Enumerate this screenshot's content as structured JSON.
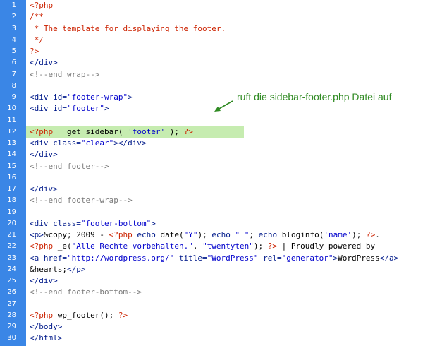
{
  "editor": {
    "gutter_color": "#3a86e6",
    "highlight_color": "#c6ecb0",
    "highlight_line": 12,
    "lines": [
      {
        "n": "1",
        "segs": [
          {
            "t": "<?php",
            "c": "php"
          }
        ]
      },
      {
        "n": "2",
        "segs": [
          {
            "t": "/**",
            "c": "php"
          }
        ]
      },
      {
        "n": "3",
        "segs": [
          {
            "t": " * The template for displaying the footer.",
            "c": "php"
          }
        ]
      },
      {
        "n": "4",
        "segs": [
          {
            "t": " */",
            "c": "php"
          }
        ]
      },
      {
        "n": "5",
        "segs": [
          {
            "t": "?>",
            "c": "php"
          }
        ]
      },
      {
        "n": "6",
        "segs": [
          {
            "t": "</div>",
            "c": "tag"
          }
        ]
      },
      {
        "n": "7",
        "segs": [
          {
            "t": "<!--end wrap-->",
            "c": "cm"
          }
        ]
      },
      {
        "n": "8",
        "segs": []
      },
      {
        "n": "9",
        "segs": [
          {
            "t": "<div id=",
            "c": "tag"
          },
          {
            "t": "\"footer-wrap\"",
            "c": "str"
          },
          {
            "t": ">",
            "c": "tag"
          }
        ]
      },
      {
        "n": "10",
        "segs": [
          {
            "t": "<div id=",
            "c": "tag"
          },
          {
            "t": "\"footer\"",
            "c": "str"
          },
          {
            "t": ">",
            "c": "tag"
          }
        ]
      },
      {
        "n": "11",
        "segs": []
      },
      {
        "n": "12",
        "segs": [
          {
            "t": "<?php",
            "c": "php"
          },
          {
            "t": "   get_sidebar( ",
            "c": "txt"
          },
          {
            "t": "'footer'",
            "c": "str"
          },
          {
            "t": " ); ",
            "c": "txt"
          },
          {
            "t": "?>",
            "c": "php"
          }
        ]
      },
      {
        "n": "13",
        "segs": [
          {
            "t": "<div class=",
            "c": "tag"
          },
          {
            "t": "\"clear\"",
            "c": "str"
          },
          {
            "t": "></div>",
            "c": "tag"
          }
        ]
      },
      {
        "n": "14",
        "segs": [
          {
            "t": "</div>",
            "c": "tag"
          }
        ]
      },
      {
        "n": "15",
        "segs": [
          {
            "t": "<!--end footer-->",
            "c": "cm"
          }
        ]
      },
      {
        "n": "16",
        "segs": []
      },
      {
        "n": "17",
        "segs": [
          {
            "t": "</div>",
            "c": "tag"
          }
        ]
      },
      {
        "n": "18",
        "segs": [
          {
            "t": "<!--end footer-wrap-->",
            "c": "cm"
          }
        ]
      },
      {
        "n": "19",
        "segs": []
      },
      {
        "n": "20",
        "segs": [
          {
            "t": "<div class=",
            "c": "tag"
          },
          {
            "t": "\"footer-bottom\"",
            "c": "str"
          },
          {
            "t": ">",
            "c": "tag"
          }
        ]
      },
      {
        "n": "21",
        "segs": [
          {
            "t": "<p>",
            "c": "tag"
          },
          {
            "t": "&copy; 2009 - ",
            "c": "txt"
          },
          {
            "t": "<?php",
            "c": "php"
          },
          {
            "t": " echo ",
            "c": "tag"
          },
          {
            "t": "date(",
            "c": "txt"
          },
          {
            "t": "\"Y\"",
            "c": "str"
          },
          {
            "t": "); ",
            "c": "txt"
          },
          {
            "t": "echo ",
            "c": "tag"
          },
          {
            "t": "\" \"",
            "c": "str"
          },
          {
            "t": "; ",
            "c": "txt"
          },
          {
            "t": "echo ",
            "c": "tag"
          },
          {
            "t": "bloginfo(",
            "c": "txt"
          },
          {
            "t": "'name'",
            "c": "str"
          },
          {
            "t": "); ",
            "c": "txt"
          },
          {
            "t": "?>",
            "c": "php"
          },
          {
            "t": ".",
            "c": "txt"
          }
        ]
      },
      {
        "n": "22",
        "segs": [
          {
            "t": "<?php",
            "c": "php"
          },
          {
            "t": " _e(",
            "c": "txt"
          },
          {
            "t": "\"Alle Rechte vorbehalten.\"",
            "c": "str"
          },
          {
            "t": ", ",
            "c": "txt"
          },
          {
            "t": "\"twentyten\"",
            "c": "str"
          },
          {
            "t": "); ",
            "c": "txt"
          },
          {
            "t": "?>",
            "c": "php"
          },
          {
            "t": " | Proudly powered by",
            "c": "txt"
          }
        ]
      },
      {
        "n": "23",
        "segs": [
          {
            "t": "<a href=",
            "c": "tag"
          },
          {
            "t": "\"http://wordpress.org/\"",
            "c": "str"
          },
          {
            "t": " title=",
            "c": "tag"
          },
          {
            "t": "\"WordPress\"",
            "c": "str"
          },
          {
            "t": " rel=",
            "c": "tag"
          },
          {
            "t": "\"generator\"",
            "c": "str"
          },
          {
            "t": ">",
            "c": "tag"
          },
          {
            "t": "WordPress",
            "c": "txt"
          },
          {
            "t": "</a>",
            "c": "tag"
          }
        ]
      },
      {
        "n": "24",
        "segs": [
          {
            "t": "&hearts;",
            "c": "txt"
          },
          {
            "t": "</p>",
            "c": "tag"
          }
        ]
      },
      {
        "n": "25",
        "segs": [
          {
            "t": "</div>",
            "c": "tag"
          }
        ]
      },
      {
        "n": "26",
        "segs": [
          {
            "t": "<!--end footer-bottom-->",
            "c": "cm"
          }
        ]
      },
      {
        "n": "27",
        "segs": []
      },
      {
        "n": "28",
        "segs": [
          {
            "t": "<?php",
            "c": "php"
          },
          {
            "t": " wp_footer(); ",
            "c": "txt"
          },
          {
            "t": "?>",
            "c": "php"
          }
        ]
      },
      {
        "n": "29",
        "segs": [
          {
            "t": "</body>",
            "c": "tag"
          }
        ]
      },
      {
        "n": "30",
        "segs": [
          {
            "t": "</html>",
            "c": "tag"
          }
        ]
      }
    ]
  },
  "annotation": {
    "text": "ruft die sidebar-footer.php Datei auf",
    "color": "#2f8a22",
    "arrow_icon": "arrow-down-left-icon"
  }
}
